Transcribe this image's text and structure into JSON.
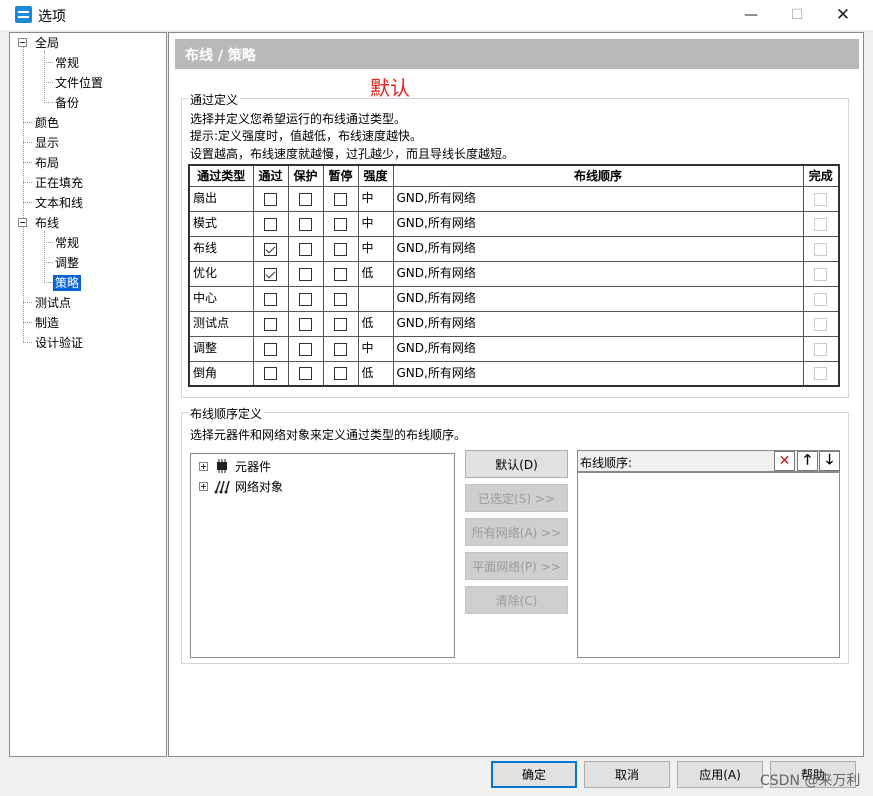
{
  "window": {
    "title": "选项",
    "minimize": "—",
    "maximize": "☐",
    "close": "✕"
  },
  "tree": {
    "items": [
      {
        "label": "全局"
      },
      {
        "label": "常规"
      },
      {
        "label": "文件位置"
      },
      {
        "label": "备份"
      },
      {
        "label": "颜色"
      },
      {
        "label": "显示"
      },
      {
        "label": "布局"
      },
      {
        "label": "正在填充"
      },
      {
        "label": "文本和线"
      },
      {
        "label": "布线"
      },
      {
        "label": "常规"
      },
      {
        "label": "调整"
      },
      {
        "label": "策略"
      },
      {
        "label": "测试点"
      },
      {
        "label": "制造"
      },
      {
        "label": "设计验证"
      }
    ],
    "selected": "策略"
  },
  "header": {
    "title": "布线 / 策略"
  },
  "annotation": "默认",
  "pass_definition": {
    "title": "通过定义",
    "lines": [
      "选择并定义您希望运行的布线通过类型。",
      "提示:定义强度时，值越低，布线速度越快。",
      "设置越高，布线速度就越慢，过孔越少，而且导线长度越短。"
    ],
    "columns": [
      "通过类型",
      "通过",
      "保护",
      "暂停",
      "强度",
      "布线顺序",
      "完成"
    ],
    "rows": [
      {
        "type": "扇出",
        "pass": false,
        "protect": false,
        "pause": false,
        "strength": "中",
        "order": "GND,所有网络"
      },
      {
        "type": "模式",
        "pass": false,
        "protect": false,
        "pause": false,
        "strength": "中",
        "order": "GND,所有网络"
      },
      {
        "type": "布线",
        "pass": true,
        "protect": false,
        "pause": false,
        "strength": "中",
        "order": "GND,所有网络"
      },
      {
        "type": "优化",
        "pass": true,
        "protect": false,
        "pause": false,
        "strength": "低",
        "order": "GND,所有网络"
      },
      {
        "type": "中心",
        "pass": false,
        "protect": false,
        "pause": false,
        "strength": "",
        "order": "GND,所有网络"
      },
      {
        "type": "测试点",
        "pass": false,
        "protect": false,
        "pause": false,
        "strength": "低",
        "order": "GND,所有网络"
      },
      {
        "type": "调整",
        "pass": false,
        "protect": false,
        "pause": false,
        "strength": "中",
        "order": "GND,所有网络"
      },
      {
        "type": "倒角",
        "pass": false,
        "protect": false,
        "pause": false,
        "strength": "低",
        "order": "GND,所有网络"
      }
    ]
  },
  "routing_order": {
    "title": "布线顺序定义",
    "description": "选择元器件和网络对象来定义通过类型的布线顺序。",
    "objects": [
      {
        "label": "元器件"
      },
      {
        "label": "网络对象"
      }
    ],
    "buttons": {
      "default": "默认(D)",
      "selected": "已选定(S) >>",
      "all_nets": "所有网络(A) >>",
      "plane_nets": "平面网络(P) >>",
      "clear": "清除(C)"
    },
    "order_label": "布线顺序:",
    "delete_icon": "✕",
    "up_icon": "🡑",
    "down_icon": "🡓"
  },
  "dialog_buttons": {
    "ok": "确定",
    "cancel": "取消",
    "apply": "应用(A)",
    "help": "帮助"
  },
  "watermark": "CSDN @来万利"
}
